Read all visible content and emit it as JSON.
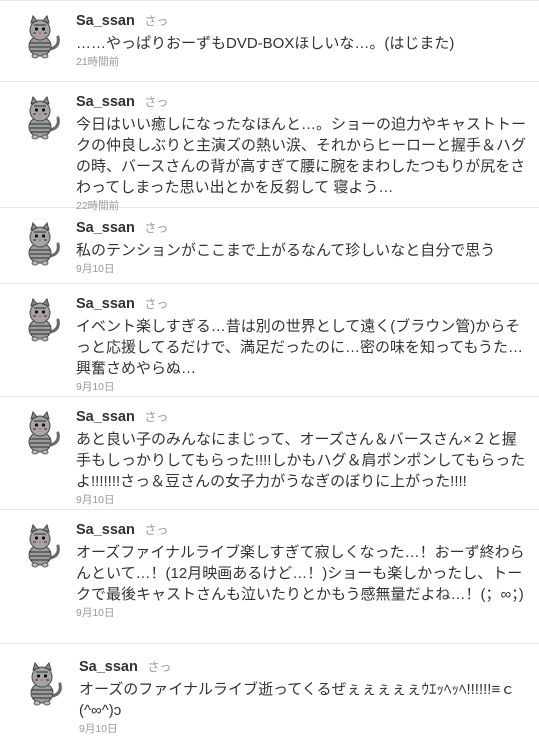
{
  "tweets": [
    {
      "screen_name": "Sa_ssan",
      "name": "さっ",
      "text": "……やっぱりおーずもDVD-BOXほしいな…。(はじまた)",
      "time": "21時間前"
    },
    {
      "screen_name": "Sa_ssan",
      "name": "さっ",
      "text": "今日はいい癒しになったなほんと…。ショーの迫力やキャストトークの仲良しぶりと主演ズの熱い涙、それからヒーローと握手＆ハグの時、バースさんの背が高すぎて腰に腕をまわしたつもりが尻をさわってしまった思い出とかを反芻して 寝よう…",
      "time": "22時間前"
    },
    {
      "screen_name": "Sa_ssan",
      "name": "さっ",
      "text": "私のテンションがここまで上がるなんて珍しいなと自分で思う",
      "time": "9月10日"
    },
    {
      "screen_name": "Sa_ssan",
      "name": "さっ",
      "text": "イベント楽しすぎる…昔は別の世界として遠く(ブラウン管)からそっと応援してるだけで、満足だったのに…密の味を知ってもうた…興奮さめやらぬ…",
      "time": "9月10日"
    },
    {
      "screen_name": "Sa_ssan",
      "name": "さっ",
      "text": "あと良い子のみんなにまじって、オーズさん＆バースさん×２と握手もしっかりしてもらった!!!!しかもハグ＆肩ポンポンしてもらったよ!!!!!!!さっ＆豆さんの女子力がうなぎのぼりに上がった!!!!",
      "time": "9月10日"
    },
    {
      "screen_name": "Sa_ssan",
      "name": "さっ",
      "text": "オーズファイナルライブ楽しすぎて寂しくなった…！おーず終わらんといて…！(12月映画あるけど…！)ショーも楽しかったし、トークで最後キャストさんも泣いたりとかもう感無量だよね…！(；∞；)",
      "time": "9月10日"
    },
    {
      "screen_name": "Sa_ssan",
      "name": "さっ",
      "text": "オーズのファイナルライブ逝ってくるぜぇぇぇぇぇｳｴｯﾍｯﾍ!!!!!!≡ｃ(^∞^)ɔ",
      "time": "9月10日"
    }
  ]
}
